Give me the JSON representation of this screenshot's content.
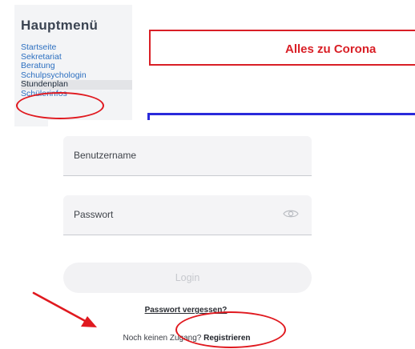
{
  "sidebar": {
    "title": "Hauptmenü",
    "items": [
      {
        "label": "Startseite"
      },
      {
        "label": "Sekretariat"
      },
      {
        "label": "Beratung"
      },
      {
        "label": "Schulpsychologin"
      },
      {
        "label": "Stundenplan"
      },
      {
        "label": "Schülerinfos"
      }
    ]
  },
  "banner": {
    "text": "Alles zu Corona"
  },
  "login": {
    "username_label": "Benutzername",
    "password_label": "Passwort",
    "login_button": "Login",
    "forgot_password": "Passwort vergessen?",
    "no_account_text": "Noch keinen Zugang?",
    "register_link": "Registrieren"
  },
  "colors": {
    "annotation_red": "#e0191f",
    "banner_red": "#d91f26",
    "banner_blue": "#2a2adb",
    "link_blue": "#2c6fc0"
  }
}
